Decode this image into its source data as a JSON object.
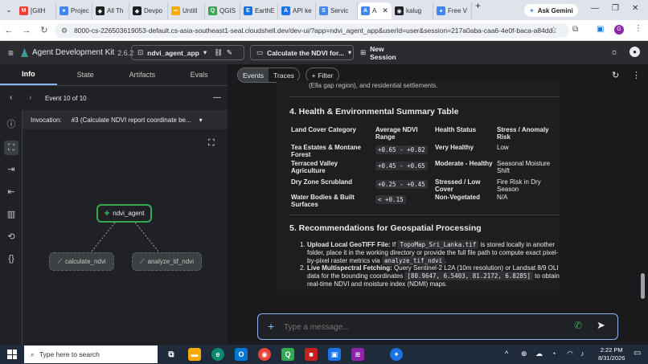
{
  "browser": {
    "tabs": [
      {
        "label": "[GitH",
        "fav": "M",
        "color": "#ea4335"
      },
      {
        "label": "Projec",
        "fav": "●",
        "color": "#4285f4"
      },
      {
        "label": "All Th",
        "fav": "◆",
        "color": "#202124"
      },
      {
        "label": "Devpo",
        "fav": "◆",
        "color": "#202124"
      },
      {
        "label": "Untitl",
        "fav": "∞",
        "color": "#f9ab00"
      },
      {
        "label": "QGIS",
        "fav": "Q",
        "color": "#34a853"
      },
      {
        "label": "EarthE",
        "fav": "E",
        "color": "#1a73e8"
      },
      {
        "label": "API ke",
        "fav": "A",
        "color": "#1a73e8"
      },
      {
        "label": "Servic",
        "fav": "S",
        "color": "#4285f4"
      },
      {
        "label": "A",
        "fav": "A",
        "color": "#4285f4"
      },
      {
        "label": "kalug",
        "fav": "◉",
        "color": "#202124"
      },
      {
        "label": "Free V",
        "fav": "✦",
        "color": "#4285f4"
      }
    ],
    "new_tab": "+",
    "ask_gemini": "Ask Gemini",
    "url": "8000-cs-226503619053-default.cs-asia-southeast1-seal.cloudshell.dev/dev-ui/?app=ndvi_agent_app&userId=user&session=217a0aba-caa6-4e0f-baca-a84dd..."
  },
  "app": {
    "title": "Agent Development Kit",
    "version": "2.6.2",
    "agent_select": "ndvi_agent_app",
    "session_select": "Calculate the NDVI for...",
    "new_session": "New Session"
  },
  "left": {
    "tabs": [
      "Info",
      "State",
      "Artifacts",
      "Evals"
    ],
    "event_label": "Event 10 of 10",
    "invocation_label": "Invocation:",
    "invocation_value": "#3 (Calculate NDVI report coordinate be...",
    "nodes": {
      "root": "ndvi_agent",
      "child1": "calculate_ndvi",
      "child2": "analyze_tif_ndvi"
    }
  },
  "right": {
    "tabs": [
      "Events",
      "Traces"
    ],
    "filter": "Filter",
    "cut_text": "(Ella gap region), and residential settlements.",
    "section4_title": "4. Health & Environmental Summary Table",
    "table_headers": [
      "Land Cover Category",
      "Average NDVI Range",
      "Health Status",
      "Stress / Anomaly Risk"
    ],
    "table_rows": [
      [
        "Tea Estates & Montane Forest",
        "+0.65 - +0.82",
        "Very Healthy",
        "Low"
      ],
      [
        "Terraced Valley Agriculture",
        "+0.45 - +0.65",
        "Moderate - Healthy",
        "Seasonal Moisture Shift"
      ],
      [
        "Dry Zone Scrubland",
        "+0.25 - +0.45",
        "Stressed / Low Cover",
        "Fire Risk in Dry Season"
      ],
      [
        "Water Bodies & Built Surfaces",
        "< +0.15",
        "Non-Vegetated",
        "N/A"
      ]
    ],
    "section5_title": "5. Recommendations for Geospatial Processing",
    "rec1_num": "1.",
    "rec1_bold": "Upload Local GeoTIFF File:",
    "rec1_a": " If ",
    "rec1_code1": "TopoMap_Sri_Lanka.tif",
    "rec1_b": " is stored locally in another folder, place it in the working directory or provide the full file path to compute exact pixel-by-pixel raster metrics via ",
    "rec1_code2": "analyze_tif_ndvi",
    "rec1_c": ".",
    "rec2_num": "2.",
    "rec2_bold": "Live Multispectral Fetching:",
    "rec2_a": " Query Sentinel-2 L2A (10m resolution) or Landsat 8/9 OLI data for the bounding coordinates ",
    "rec2_code": "[80.9647, 6.5403, 81.2172, 6.8285]",
    "rec2_b": " to obtain real-time NDVI and moisture index (NDMI) maps.",
    "input_placeholder": "Type a message..."
  },
  "taskbar": {
    "search": "Type here to search",
    "time": "2:22 PM",
    "date": "8/31/2026"
  },
  "colors": {
    "accent": "#8ab4f8",
    "node_green": "#34a853",
    "panel": "#202124"
  }
}
